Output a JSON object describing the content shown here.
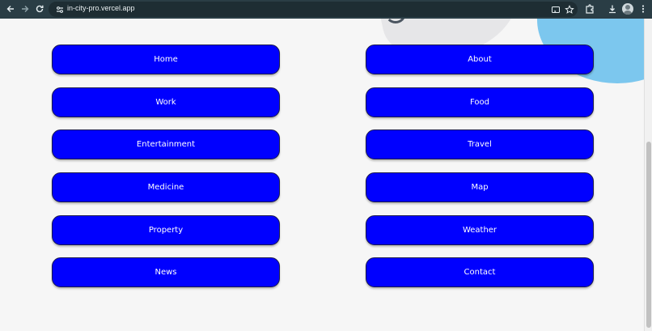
{
  "browser": {
    "url": "in-city-pro.vercel.app",
    "icons": [
      "back-arrow-icon",
      "forward-arrow-icon",
      "reload-icon",
      "site-settings-icon",
      "cast-icon",
      "bookmark-star-icon",
      "extensions-icon",
      "download-icon",
      "profile-avatar-icon",
      "more-menu-icon"
    ]
  },
  "nav": {
    "left": [
      {
        "label": "Home"
      },
      {
        "label": "Work"
      },
      {
        "label": "Entertainment"
      },
      {
        "label": "Medicine"
      },
      {
        "label": "Property"
      },
      {
        "label": "News"
      }
    ],
    "right": [
      {
        "label": "About"
      },
      {
        "label": "Food"
      },
      {
        "label": "Travel"
      },
      {
        "label": "Map"
      },
      {
        "label": "Weather"
      },
      {
        "label": "Contact"
      }
    ]
  },
  "colors": {
    "button_bg": "#0000ff",
    "button_text": "#ffffff",
    "page_bg": "#f6f6f6",
    "toolbar_bg": "#2a3d45",
    "accent_blob": "#7cc7ee"
  }
}
